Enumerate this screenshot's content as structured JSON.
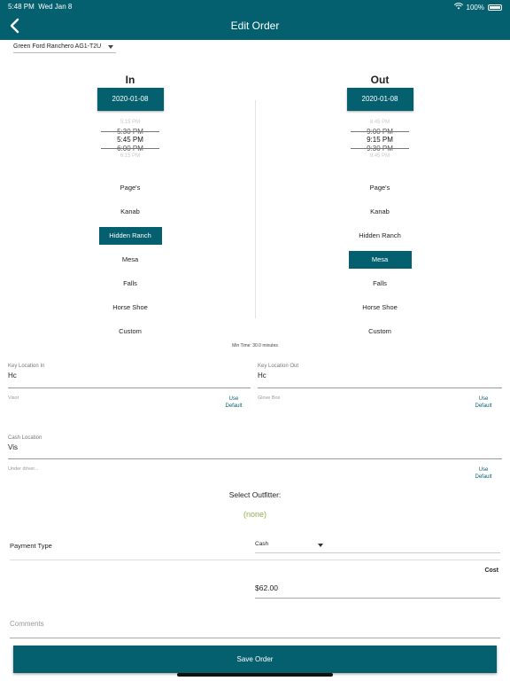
{
  "status": {
    "time": "5:48 PM",
    "date": "Wed Jan 8",
    "battery": "100%"
  },
  "header": {
    "title": "Edit Order"
  },
  "vehicle": {
    "selected": "Green Ford Ranchero AG1-T2U"
  },
  "in": {
    "heading": "In",
    "date": "2020-01-08",
    "times": [
      "5:15 PM",
      "5:30 PM",
      "5:45 PM",
      "6:00 PM",
      "6:15 PM"
    ],
    "locations": [
      "Page's",
      "Kanab",
      "Hidden Ranch",
      "Mesa",
      "Falls",
      "Horse Shoe",
      "Custom"
    ],
    "selected_location": "Hidden Ranch"
  },
  "out": {
    "heading": "Out",
    "date": "2020-01-08",
    "times": [
      "8:45 PM",
      "9:00 PM",
      "9:15 PM",
      "9:30 PM",
      "9:45 PM"
    ],
    "locations": [
      "Page's",
      "Kanab",
      "Hidden Ranch",
      "Mesa",
      "Falls",
      "Horse Shoe",
      "Custom"
    ],
    "selected_location": "Mesa"
  },
  "min_time": "Min Time: 30.0 minutes",
  "key_location_in": {
    "label": "Key Location In",
    "value": "Hc"
  },
  "key_location_out": {
    "label": "Key Location Out",
    "value": "Hc"
  },
  "visor": {
    "label": "Visor",
    "use_default": "Use Default"
  },
  "glove_box": {
    "label": "Glove Box",
    "use_default": "Use Default"
  },
  "cash_location": {
    "label": "Cash Location",
    "value": "Vis"
  },
  "under_driver": {
    "label": "Under driver...",
    "use_default": "Use Default"
  },
  "outfitter": {
    "label": "Select Outfitter:",
    "value": "(none)"
  },
  "payment": {
    "label": "Payment Type",
    "value": "Cash"
  },
  "cost": {
    "label": "Cost",
    "value": "$62.00"
  },
  "comments": {
    "placeholder": "Comments"
  },
  "save": {
    "label": "Save Order"
  },
  "colors": {
    "primary": "#04606f",
    "outfitter_none": "#8db04e"
  }
}
